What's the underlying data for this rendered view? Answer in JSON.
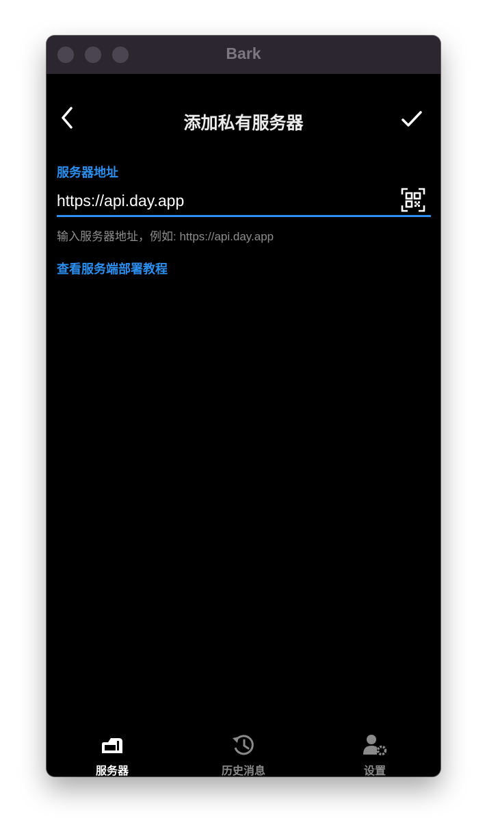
{
  "window": {
    "title": "Bark"
  },
  "navbar": {
    "title": "添加私有服务器",
    "back_icon": "chevron-left-icon",
    "confirm_icon": "checkmark-icon"
  },
  "form": {
    "field_label": "服务器地址",
    "server_url_value": "https://api.day.app",
    "qr_icon": "qr-code-scan-icon",
    "helper_text": "输入服务器地址，例如: https://api.day.app",
    "tutorial_link": "查看服务端部署教程"
  },
  "tabbar": {
    "items": [
      {
        "label": "服务器",
        "icon": "server-icon",
        "active": true
      },
      {
        "label": "历史消息",
        "icon": "history-icon",
        "active": false
      },
      {
        "label": "设置",
        "icon": "user-settings-icon",
        "active": false
      }
    ]
  },
  "colors": {
    "accent": "#2c8ff0",
    "background": "#000000",
    "titlebar": "#2b2630",
    "tab_active": "#ffffff",
    "tab_inactive": "#8a8a8a",
    "helper_text": "#8e8e8e"
  }
}
